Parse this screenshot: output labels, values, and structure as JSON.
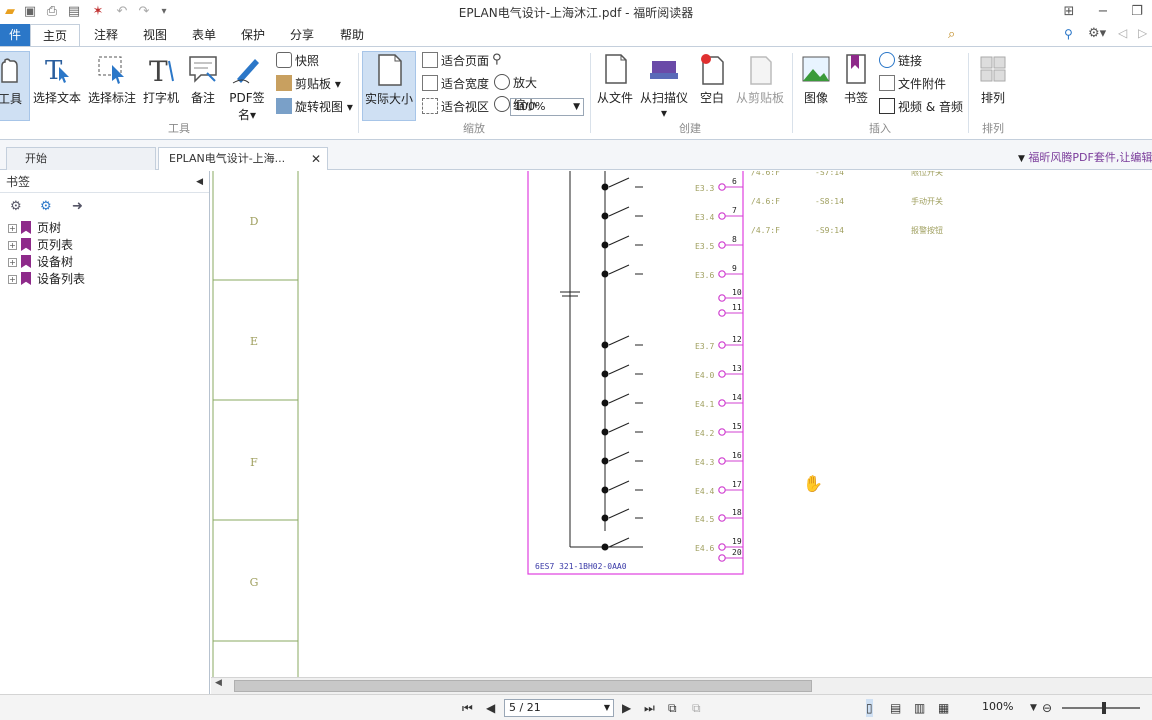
{
  "window": {
    "title": "EPLAN电气设计-上海沐江.pdf - 福昕阅读器"
  },
  "menu": {
    "tabs": [
      "件",
      "主页",
      "注释",
      "视图",
      "表单",
      "保护",
      "分享",
      "帮助"
    ]
  },
  "search": {
    "placeholder": "查找"
  },
  "ribbon": {
    "tools": {
      "hand": "工具",
      "select_text": "选择文本",
      "select_annot": "选择标注",
      "typewriter": "打字机",
      "note": "备注",
      "pdf_sign": "PDF签名",
      "snapshot": "快照",
      "clipboard": "剪贴板",
      "rotate": "旋转视图",
      "group": "工具"
    },
    "zoom": {
      "actual_size": "实际大小",
      "fit_page": "适合页面",
      "fit_width": "适合宽度",
      "fit_visible": "适合视区",
      "zoom_value": "100%",
      "zoom_in": "放大",
      "zoom_out": "缩小",
      "group": "缩放"
    },
    "create": {
      "from_file": "从文件",
      "from_scanner": "从扫描仪",
      "blank": "空白",
      "from_clipboard": "从剪贴板",
      "group": "创建"
    },
    "insert": {
      "image": "图像",
      "bookmark": "书签",
      "link": "链接",
      "file_attach": "文件附件",
      "video_audio": "视频 & 音频",
      "group": "插入"
    },
    "arrange": {
      "arrange": "排列",
      "group": "排列"
    }
  },
  "doc_tabs": {
    "start": "开始",
    "doc": "EPLAN电气设计-上海..."
  },
  "ad_banner": "福昕风腾PDF套件,让编辑",
  "sidebar": {
    "title": "书签",
    "items": [
      "页树",
      "页列表",
      "设备树",
      "设备列表"
    ]
  },
  "drawing": {
    "row_letters": [
      "D",
      "E",
      "F",
      "G"
    ],
    "module_label": "6ES7 321-1BH02-0AA0",
    "inputs": [
      {
        "addr": "E3.3",
        "pin": "6"
      },
      {
        "addr": "E3.4",
        "pin": "7"
      },
      {
        "addr": "E3.5",
        "pin": "8"
      },
      {
        "addr": "E3.6",
        "pin": "9"
      },
      {
        "addr": "",
        "pin": "10"
      },
      {
        "addr": "",
        "pin": "11"
      },
      {
        "addr": "E3.7",
        "pin": "12"
      },
      {
        "addr": "E4.0",
        "pin": "13"
      },
      {
        "addr": "E4.1",
        "pin": "14"
      },
      {
        "addr": "E4.2",
        "pin": "15"
      },
      {
        "addr": "E4.3",
        "pin": "16"
      },
      {
        "addr": "E4.4",
        "pin": "17"
      },
      {
        "addr": "E4.5",
        "pin": "18"
      },
      {
        "addr": "E4.6",
        "pin": "19"
      },
      {
        "addr": "",
        "pin": "20"
      }
    ],
    "xrefs": [
      {
        "ref": "/4.6:F",
        "dev": "-S7:14",
        "desc": "限位开关"
      },
      {
        "ref": "/4.6:F",
        "dev": "-S8:14",
        "desc": "手动开关"
      },
      {
        "ref": "/4.7:F",
        "dev": "-S9:14",
        "desc": "报警按钮"
      }
    ]
  },
  "status": {
    "page": "5 / 21",
    "zoom": "100%"
  },
  "colors": {
    "accent": "#2b77c8",
    "module_border": "#e040e0",
    "frame_green": "#8aa860",
    "label_olive": "#a0a060",
    "module_text": "#3a3aa8"
  }
}
